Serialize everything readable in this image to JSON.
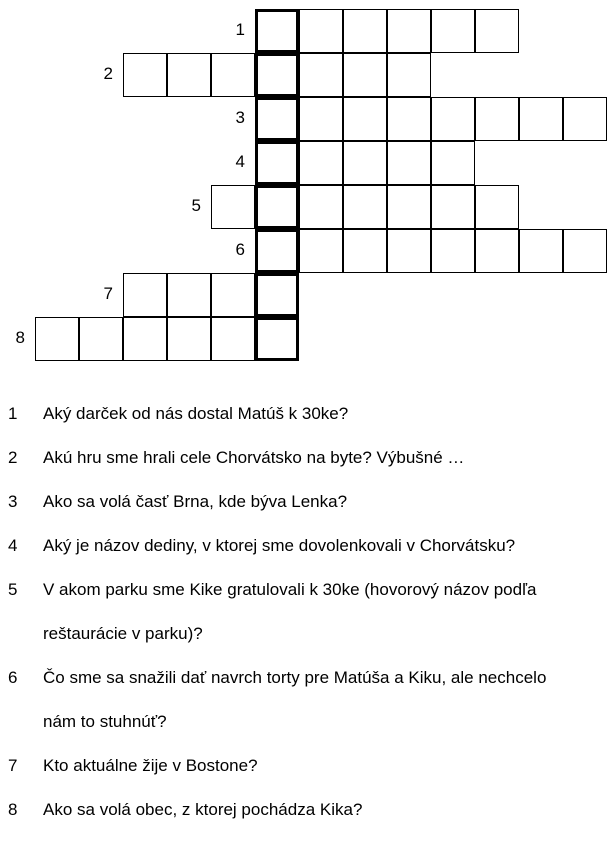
{
  "puzzle": {
    "rows": [
      {
        "number": "1",
        "cells_before": 0,
        "cells_after": 5
      },
      {
        "number": "2",
        "cells_before": 3,
        "cells_after": 3
      },
      {
        "number": "3",
        "cells_before": 0,
        "cells_after": 7
      },
      {
        "number": "4",
        "cells_before": 0,
        "cells_after": 4
      },
      {
        "number": "5",
        "cells_before": 1,
        "cells_after": 5
      },
      {
        "number": "6",
        "cells_before": 0,
        "cells_after": 7
      },
      {
        "number": "7",
        "cells_before": 3,
        "cells_after": 0
      },
      {
        "number": "8",
        "cells_before": 5,
        "cells_after": 0
      }
    ]
  },
  "clues": [
    {
      "number": "1",
      "lines": [
        "Aký darček od nás dostal Matúš k 30ke?"
      ]
    },
    {
      "number": "2",
      "lines": [
        "Akú hru sme hrali cele Chorvátsko na byte? Výbušné …"
      ]
    },
    {
      "number": "3",
      "lines": [
        "Ako sa volá časť Brna, kde býva Lenka?"
      ]
    },
    {
      "number": "4",
      "lines": [
        "Aký je názov dediny, v ktorej sme dovolenkovali v Chorvátsku?"
      ]
    },
    {
      "number": "5",
      "lines": [
        "V akom parku sme Kike gratulovali k 30ke (hovorový názov podľa",
        "reštaurácie v parku)?"
      ]
    },
    {
      "number": "6",
      "lines": [
        "Čo sme sa snažili dať navrch torty pre Matúša a Kiku, ale nechcelo",
        "nám to stuhnúť?"
      ]
    },
    {
      "number": "7",
      "lines": [
        "Kto aktuálne žije v Bostone?"
      ]
    },
    {
      "number": "8",
      "lines": [
        "Ako sa volá obec, z ktorej pochádza Kika?"
      ]
    }
  ]
}
